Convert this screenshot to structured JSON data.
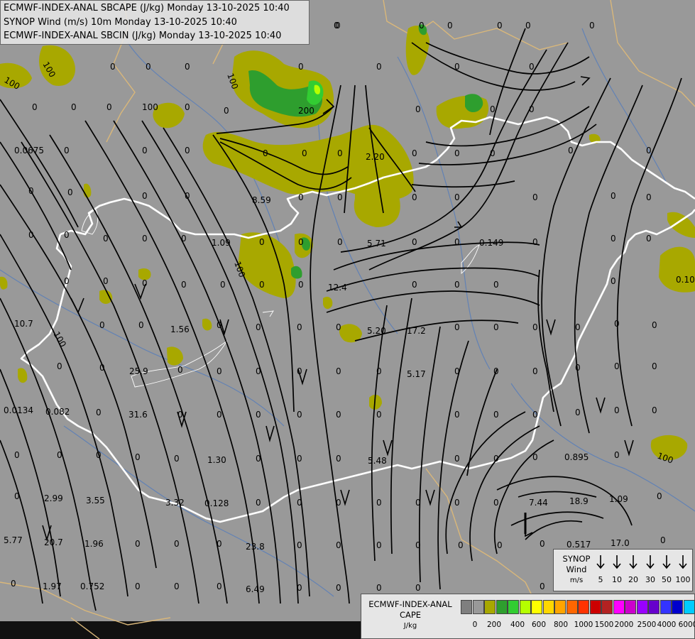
{
  "header": {
    "line1": "ECMWF-INDEX-ANAL SBCAPE (J/kg) Monday 13-10-2025 10:40",
    "line2": "SYNOP Wind (m/s) 10m Monday 13-10-2025 10:40",
    "line3": "ECMWF-INDEX-ANAL SBCIN (J/kg) Monday 13-10-2025 10:40"
  },
  "colors": {
    "background": "#999999",
    "cape_olive": "#a8a800",
    "cape_green": "#2e9e2e",
    "cape_bright_green": "#32cd32",
    "cape_yellow_green": "#b5ff00",
    "border": "#ffffff",
    "streamline": "#000000"
  },
  "map_labels": [
    {
      "text": "0",
      "cls": "v"
    },
    {
      "text": "0",
      "cls": "v"
    },
    {
      "text": "0",
      "cls": "v"
    },
    {
      "text": "0",
      "cls": "v"
    },
    {
      "text": "0.0675",
      "cls": "v"
    },
    {
      "text": "8.59",
      "cls": "v"
    },
    {
      "text": "2.20",
      "cls": "v"
    },
    {
      "text": "1.09",
      "cls": "v"
    },
    {
      "text": "5.71",
      "cls": "v"
    },
    {
      "text": "0.149",
      "cls": "v"
    },
    {
      "text": "12.4",
      "cls": "v"
    },
    {
      "text": "10.7",
      "cls": "v"
    },
    {
      "text": "1.56",
      "cls": "v"
    },
    {
      "text": "5.20",
      "cls": "v"
    },
    {
      "text": "17.2",
      "cls": "v"
    },
    {
      "text": "25.9",
      "cls": "v"
    },
    {
      "text": "5.17",
      "cls": "v"
    },
    {
      "text": "0.0134",
      "cls": "v"
    },
    {
      "text": "0.082",
      "cls": "v"
    },
    {
      "text": "31.6",
      "cls": "v"
    },
    {
      "text": "1.30",
      "cls": "v"
    },
    {
      "text": "5.48",
      "cls": "v"
    },
    {
      "text": "0.895",
      "cls": "v"
    },
    {
      "text": "2.99",
      "cls": "v"
    },
    {
      "text": "3.55",
      "cls": "v"
    },
    {
      "text": "3.32",
      "cls": "v"
    },
    {
      "text": "0.128",
      "cls": "v"
    },
    {
      "text": "7.44",
      "cls": "v"
    },
    {
      "text": "18.9",
      "cls": "v"
    },
    {
      "text": "1.09",
      "cls": "v"
    },
    {
      "text": "5.77",
      "cls": "v"
    },
    {
      "text": "20.7",
      "cls": "v"
    },
    {
      "text": "1.96",
      "cls": "v"
    },
    {
      "text": "23.8",
      "cls": "v"
    },
    {
      "text": "0.517",
      "cls": "v"
    },
    {
      "text": "17.0",
      "cls": "v"
    },
    {
      "text": "1.97",
      "cls": "v"
    },
    {
      "text": "0.752",
      "cls": "v"
    },
    {
      "text": "6.49",
      "cls": "v"
    },
    {
      "text": "0.109",
      "cls": "v"
    },
    {
      "text": "100",
      "cls": "c"
    },
    {
      "text": "100",
      "cls": "c"
    },
    {
      "text": "100",
      "cls": "c"
    },
    {
      "text": "100",
      "cls": "c"
    },
    {
      "text": "100",
      "cls": "c"
    },
    {
      "text": "200",
      "cls": "c"
    },
    {
      "text": "100",
      "cls": "c"
    },
    {
      "text": "100",
      "cls": "c"
    },
    {
      "text": "0.10",
      "cls": "v"
    },
    {
      "text": "0",
      "cls": "v"
    }
  ],
  "synop_legend": {
    "title_lines": [
      "SYNOP",
      "Wind",
      "m/s"
    ],
    "speeds": [
      "5",
      "10",
      "20",
      "30",
      "50",
      "100"
    ]
  },
  "cape_legend": {
    "title_lines": [
      "ECMWF-INDEX-ANAL",
      "CAPE",
      "J/kg"
    ],
    "swatches": [
      "#7f7f7f",
      "#999999",
      "#a8a800",
      "#2e9e2e",
      "#32cd32",
      "#b5ff00",
      "#ffff00",
      "#ffd700",
      "#ffa500",
      "#ff6600",
      "#ff3300",
      "#cc0000",
      "#b22222",
      "#ff00ff",
      "#cc00cc",
      "#9900ff",
      "#6600cc",
      "#3333ff",
      "#0000cc",
      "#00ccff",
      "#00ffff",
      "#ffffff"
    ],
    "ticks": [
      "0",
      "200",
      "400",
      "600",
      "800",
      "1000",
      "1500",
      "2000",
      "2500",
      "4000",
      "6000"
    ]
  }
}
